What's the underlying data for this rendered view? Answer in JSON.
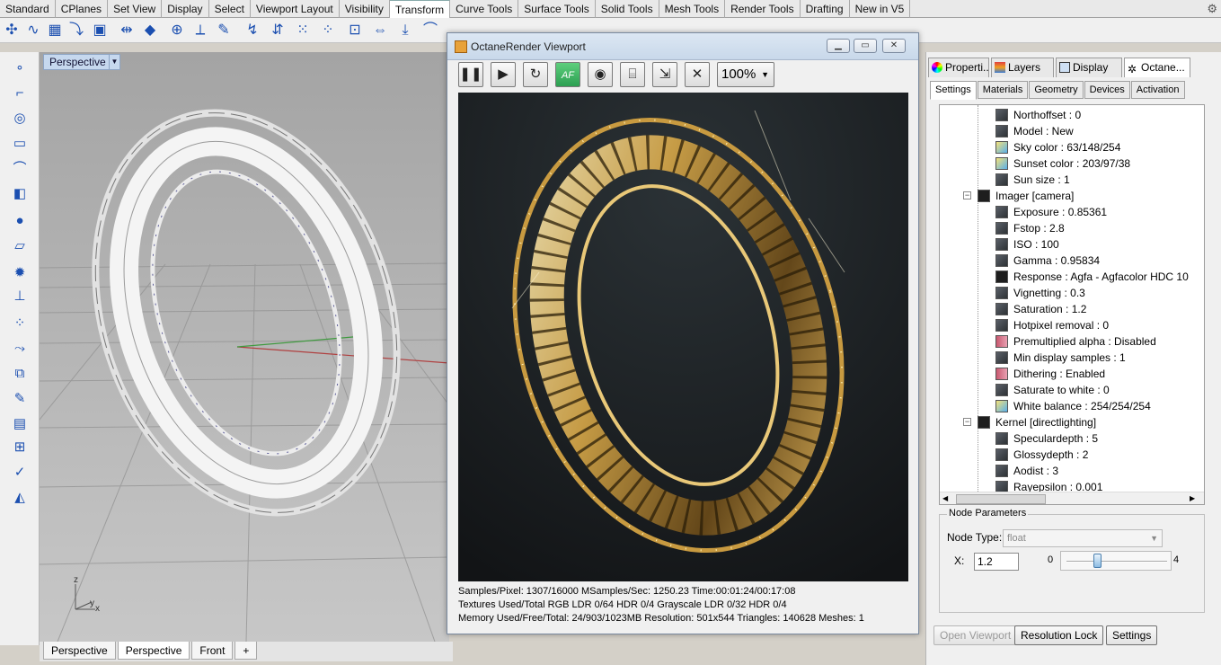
{
  "top_tabs": [
    "Standard",
    "CPlanes",
    "Set View",
    "Display",
    "Select",
    "Viewport Layout",
    "Visibility",
    "Transform",
    "Curve Tools",
    "Surface Tools",
    "Solid Tools",
    "Mesh Tools",
    "Render Tools",
    "Drafting",
    "New in V5"
  ],
  "top_tabs_active": "Transform",
  "viewport": {
    "label": "Perspective",
    "axis_z": "z",
    "axis_y": "y",
    "axis_x": "x"
  },
  "bottom_tabs": [
    "Perspective",
    "Perspective",
    "Front"
  ],
  "bottom_add": "+",
  "octane": {
    "title": "OctaneRender Viewport",
    "zoom": "100%",
    "af_label": "AF",
    "status": {
      "line1": "Samples/Pixel: 1307/16000  MSamples/Sec: 1250.23  Time:00:01:24/00:17:08",
      "line2": "Textures Used/Total RGB LDR 0/64  HDR 0/4  Grayscale LDR 0/32  HDR 0/4",
      "line3": "Memory Used/Free/Total: 24/903/1023MB  Resolution: 501x544  Triangles: 140628  Meshes:  1"
    }
  },
  "panel": {
    "tabs": [
      "Properti...",
      "Layers",
      "Display",
      "Octane..."
    ],
    "subtabs": [
      "Settings",
      "Materials",
      "Geometry",
      "Devices",
      "Activation"
    ],
    "tree": [
      {
        "label": "Northoffset : 0",
        "icon": "curve"
      },
      {
        "label": "Model : New",
        "icon": "list"
      },
      {
        "label": "Sky color : 63/148/254",
        "icon": "color"
      },
      {
        "label": "Sunset color : 203/97/38",
        "icon": "color"
      },
      {
        "label": "Sun size : 1",
        "icon": "curve"
      },
      {
        "label": "Imager  [camera]",
        "icon": "imager",
        "group": true
      },
      {
        "label": "Exposure : 0.85361",
        "icon": "curve"
      },
      {
        "label": "Fstop : 2.8",
        "icon": "curve"
      },
      {
        "label": "ISO : 100",
        "icon": "curve"
      },
      {
        "label": "Gamma : 0.95834",
        "icon": "curve"
      },
      {
        "label": "Response : Agfa - Agfacolor HDC 10",
        "icon": "imager"
      },
      {
        "label": "Vignetting : 0.3",
        "icon": "curve"
      },
      {
        "label": "Saturation : 1.2",
        "icon": "curve"
      },
      {
        "label": "Hotpixel removal : 0",
        "icon": "curve"
      },
      {
        "label": "Premultiplied alpha : Disabled",
        "icon": "toggle"
      },
      {
        "label": "Min display samples : 1",
        "icon": "curve"
      },
      {
        "label": "Dithering : Enabled",
        "icon": "toggle"
      },
      {
        "label": "Saturate to white : 0",
        "icon": "curve"
      },
      {
        "label": "White balance : 254/254/254",
        "icon": "color"
      },
      {
        "label": "Kernel  [directlighting]",
        "icon": "kernel",
        "group": true
      },
      {
        "label": "Speculardepth : 5",
        "icon": "curve"
      },
      {
        "label": "Glossydepth : 2",
        "icon": "curve"
      },
      {
        "label": "Aodist : 3",
        "icon": "curve"
      },
      {
        "label": "Rayepsilon : 0.001",
        "icon": "curve"
      }
    ],
    "node_params": {
      "title": "Node Parameters",
      "type_label": "Node Type:",
      "type_value": "float",
      "x_label": "X:",
      "x_value": "1.2",
      "min": "0",
      "max": "4",
      "slider_fraction": 0.3
    },
    "buttons": [
      "Open Viewport",
      "Resolution Lock",
      "Settings"
    ]
  },
  "colors": {
    "accent": "#1b4fb0",
    "octane_green": "#2c9f52",
    "gold": "#d4a84a"
  }
}
